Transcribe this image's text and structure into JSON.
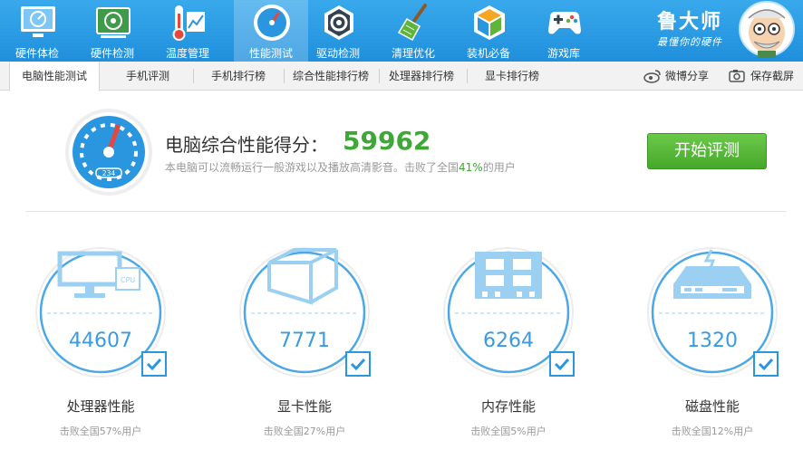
{
  "nav": {
    "items": [
      {
        "label": "硬件体检",
        "icon": "hardware-checkup-icon"
      },
      {
        "label": "硬件检测",
        "icon": "hardware-detect-icon"
      },
      {
        "label": "温度管理",
        "icon": "temperature-icon"
      },
      {
        "label": "性能测试",
        "icon": "performance-gauge-icon",
        "active": true
      },
      {
        "label": "驱动检测",
        "icon": "driver-gear-icon"
      },
      {
        "label": "清理优化",
        "icon": "broom-icon"
      },
      {
        "label": "装机必备",
        "icon": "install-box-icon"
      },
      {
        "label": "游戏库",
        "icon": "gamepad-icon"
      }
    ],
    "brand_name": "鲁大师",
    "brand_slogan": "最懂你的硬件"
  },
  "tabs": [
    {
      "label": "电脑性能测试",
      "active": true
    },
    {
      "label": "手机评测"
    },
    {
      "label": "手机排行榜"
    },
    {
      "label": "综合性能排行榜"
    },
    {
      "label": "处理器排行榜"
    },
    {
      "label": "显卡排行榜"
    }
  ],
  "share": {
    "weibo": "微博分享",
    "screenshot": "保存截屏"
  },
  "score": {
    "title": "电脑综合性能得分：",
    "value": "59962",
    "desc_prefix": "本电脑可以流畅运行一般游戏以及播放高清影音。击败了全国",
    "desc_pct": "41%",
    "desc_suffix": "的用户",
    "gauge_reading": "234",
    "start_button": "开始评测"
  },
  "cards": [
    {
      "title": "处理器性能",
      "value": "44607",
      "sub": "击败全国57%用户",
      "icon": "cpu-monitor-icon"
    },
    {
      "title": "显卡性能",
      "value": "7771",
      "sub": "击败全国27%用户",
      "icon": "graphics-cube-icon"
    },
    {
      "title": "内存性能",
      "value": "6264",
      "sub": "击败全国5%用户",
      "icon": "memory-chip-icon"
    },
    {
      "title": "磁盘性能",
      "value": "1320",
      "sub": "击败全国12%用户",
      "icon": "disk-drive-icon"
    }
  ],
  "colors": {
    "accent": "#2a96e0",
    "score_green": "#3fa735",
    "button_green": "#56b83a"
  }
}
